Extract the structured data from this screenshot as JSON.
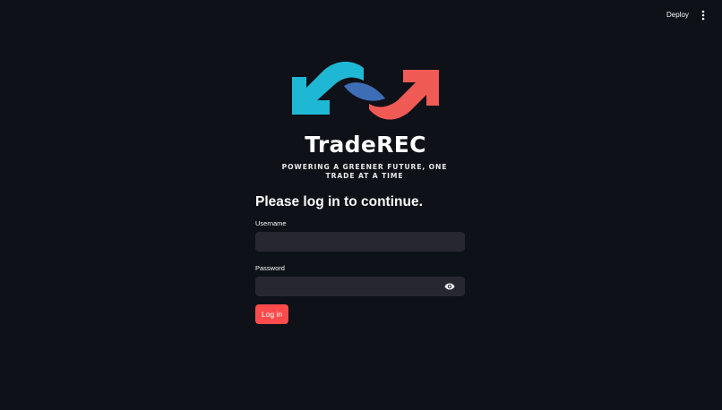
{
  "header": {
    "deploy_label": "Deploy",
    "menu_icon": "vertical-dots-icon"
  },
  "brand": {
    "name": "TradeREC",
    "tagline_line1": "POWERING A GREENER FUTURE, ONE",
    "tagline_line2": "TRADE AT A TIME",
    "colors": {
      "arrow_left": "#1fb8d4",
      "arrow_right": "#f05a55",
      "leaf": "#3d6db5"
    }
  },
  "login": {
    "title": "Please log in to continue.",
    "username_label": "Username",
    "username_value": "",
    "password_label": "Password",
    "password_value": "",
    "password_toggle_icon": "eye-icon",
    "submit_label": "Log in",
    "accent_color": "#ff4b4b"
  }
}
